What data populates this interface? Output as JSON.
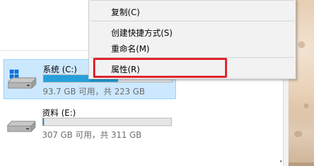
{
  "context_menu": {
    "items": [
      {
        "label": "复制(C)"
      },
      {
        "label": "创建快捷方式(S)"
      },
      {
        "label": "重命名(M)"
      },
      {
        "label": "属性(R)"
      }
    ],
    "highlighted_item": "属性(R)",
    "highlight_color": "#e0222b"
  },
  "drives": [
    {
      "name": "系统 (C:)",
      "info": "93.7 GB 可用，共 223 GB",
      "used_fraction": 0.58,
      "selected": true,
      "icon": "windows-drive-icon"
    },
    {
      "name": "资料 (E:)",
      "info": "307 GB 可用，共 311 GB",
      "used_fraction": 0.013,
      "selected": false,
      "icon": "hard-drive-icon"
    }
  ],
  "colors": {
    "selection_bg": "#cce8ff",
    "selection_border": "#99d1ff",
    "usage_bar": "#26a0da",
    "menu_bg": "#f2f2f2"
  }
}
